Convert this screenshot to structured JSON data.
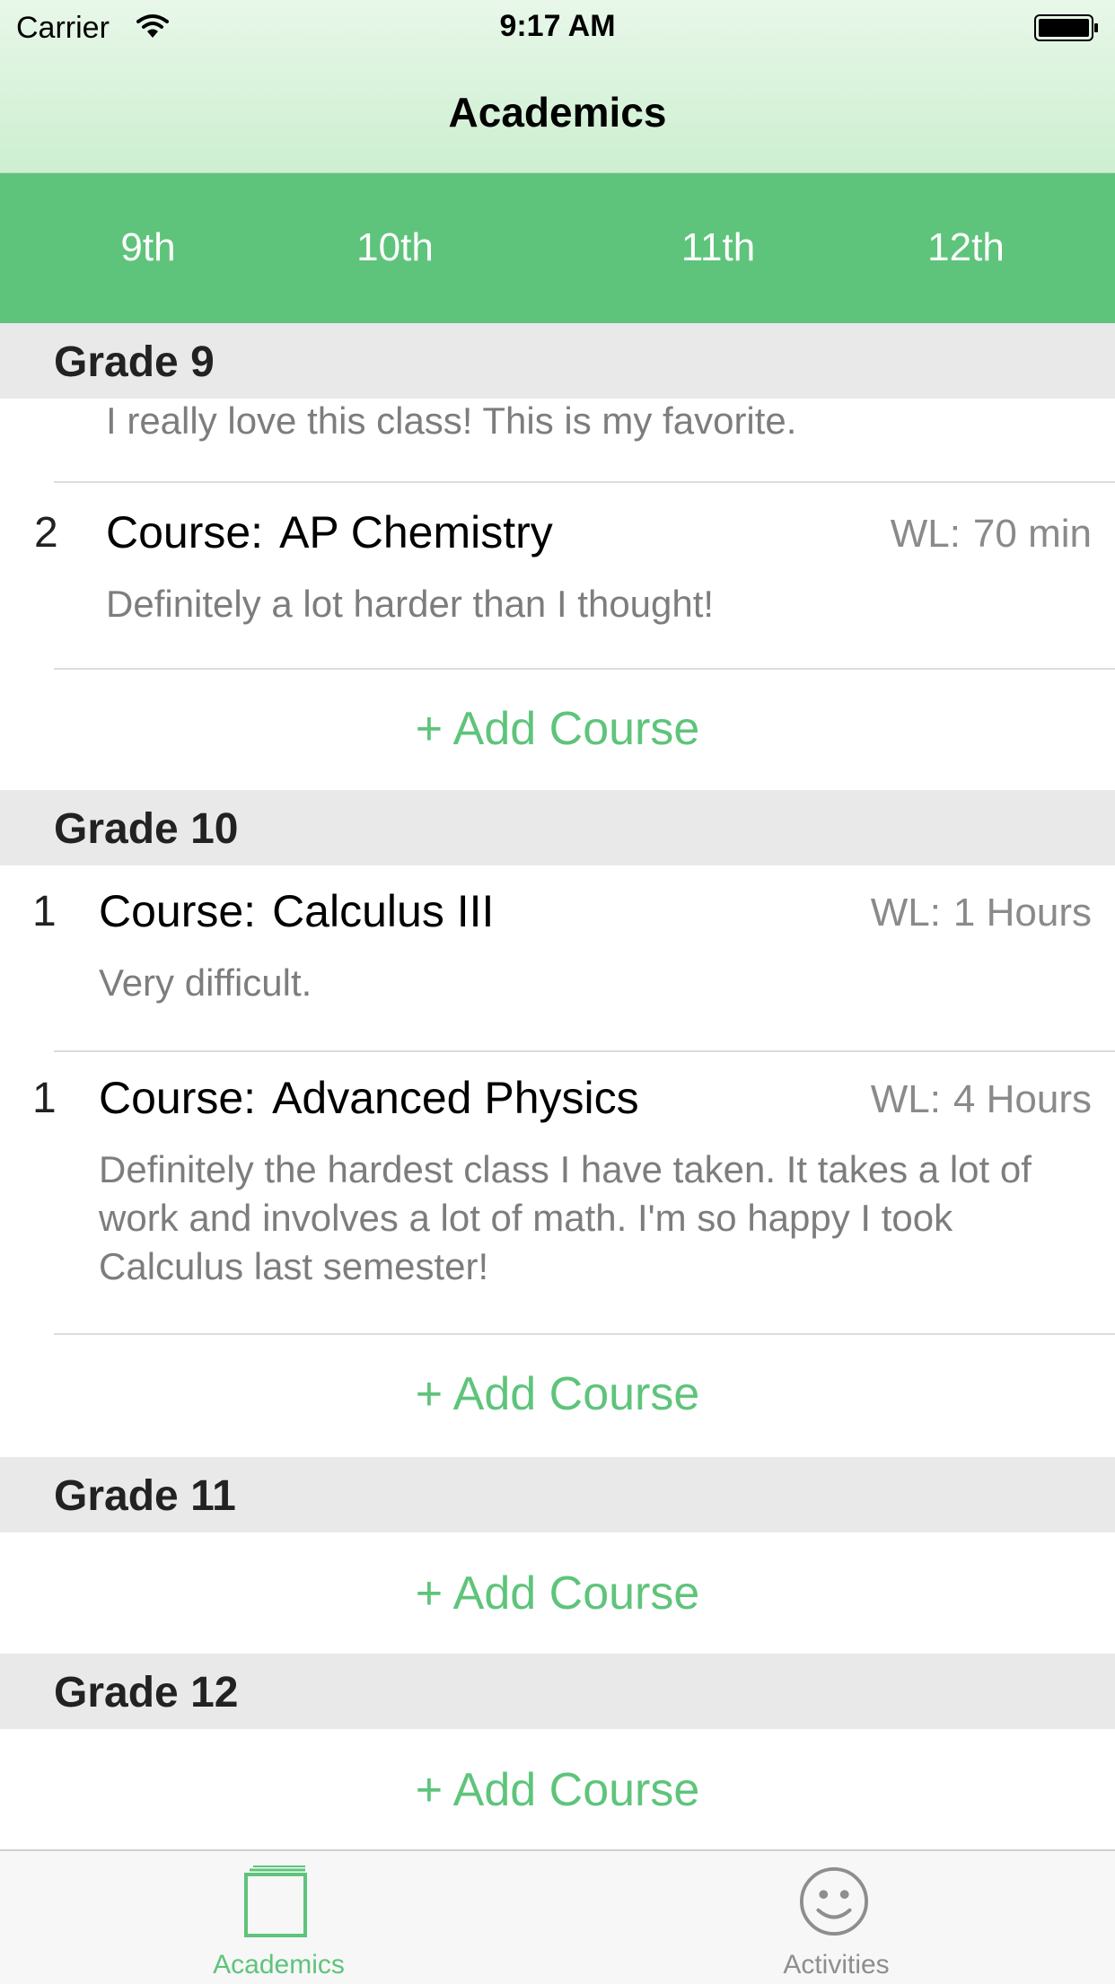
{
  "status_bar": {
    "carrier": "Carrier",
    "time": "9:17 AM"
  },
  "nav": {
    "title": "Academics"
  },
  "grade_tabs": [
    "9th",
    "10th",
    "11th",
    "12th"
  ],
  "colors": {
    "accent": "#5ec47b",
    "header_bg": "#d8f2da",
    "section_bg": "#e9e9e9",
    "inactive": "#8e8e8e"
  },
  "sections": [
    {
      "title": "Grade 9",
      "partial_note": "I really love this class! This is my favorite.",
      "courses": [
        {
          "number": "2",
          "label": "Course:",
          "name": "AP Chemistry",
          "wl_label": "WL:",
          "workload": "70 min",
          "note": "Definitely a lot harder than I thought!"
        }
      ],
      "add_label": "+ Add Course"
    },
    {
      "title": "Grade 10",
      "courses": [
        {
          "number": "1",
          "label": "Course:",
          "name": "Calculus III",
          "wl_label": "WL:",
          "workload": "1 Hours",
          "note": "Very difficult."
        },
        {
          "number": "1",
          "label": "Course:",
          "name": "Advanced Physics",
          "wl_label": "WL:",
          "workload": "4 Hours",
          "note": "Definitely the hardest class I have taken. It takes a lot of work and involves a lot of math. I'm so happy I took Calculus last semester!"
        }
      ],
      "add_label": "+ Add Course"
    },
    {
      "title": "Grade 11",
      "courses": [],
      "add_label": "+ Add Course"
    },
    {
      "title": "Grade 12",
      "courses": [],
      "add_label": "+ Add Course"
    }
  ],
  "tab_bar": {
    "items": [
      {
        "label": "Academics",
        "icon": "book-icon",
        "selected": true
      },
      {
        "label": "Activities",
        "icon": "smiley-icon",
        "selected": false
      }
    ]
  }
}
